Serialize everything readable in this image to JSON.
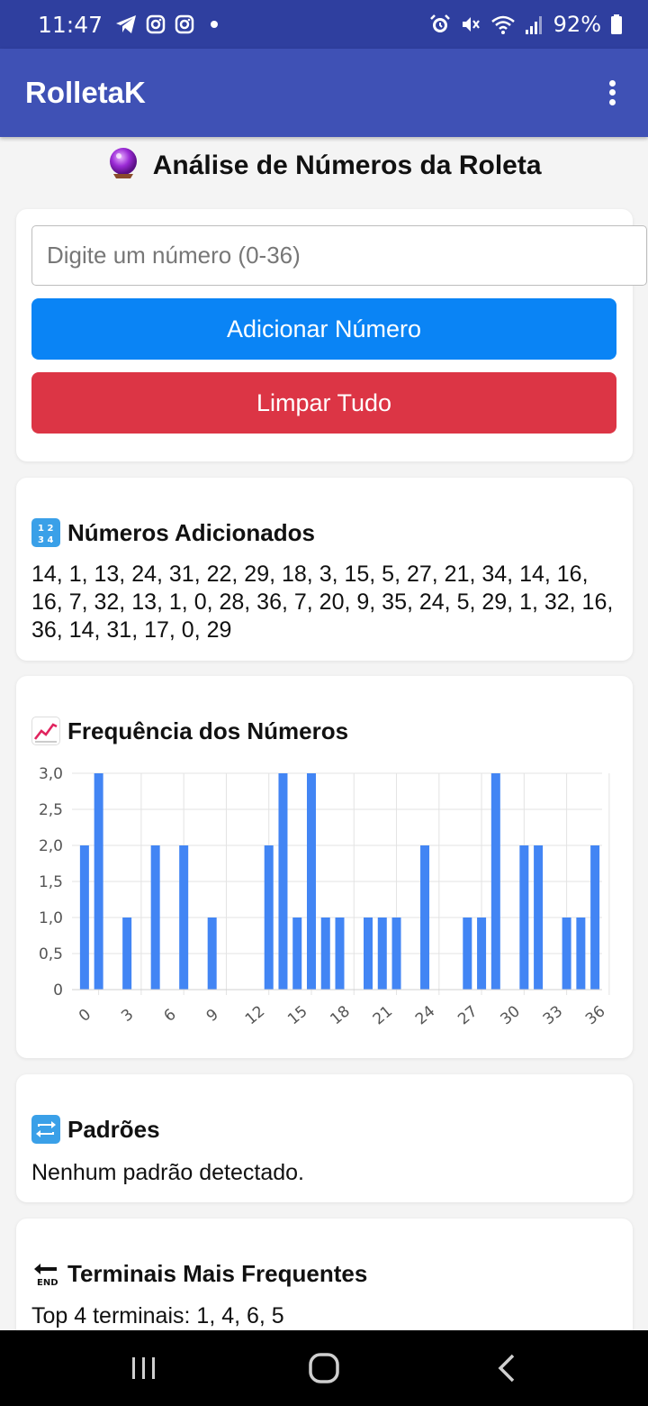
{
  "status": {
    "time": "11:47",
    "battery": "92%"
  },
  "app": {
    "title": "RolletaK"
  },
  "page": {
    "title": "Análise de Números da Roleta"
  },
  "input": {
    "placeholder": "Digite um número (0-36)",
    "value": ""
  },
  "buttons": {
    "add": "Adicionar Número",
    "clear": "Limpar Tudo"
  },
  "numbers_section": {
    "title": "Números Adicionados",
    "lines": [
      "14, 1, 13, 24, 31, 22, 29, 18, 3, 15, 5, 27, 21, 34, 14, 16,",
      "16, 7, 32, 13, 1, 0, 28, 36, 7, 20, 9, 35, 24, 5, 29, 1, 32, 16,",
      "36, 14, 31, 17, 0, 29"
    ]
  },
  "frequency_section": {
    "title": "Frequência dos Números"
  },
  "chart_data": {
    "type": "bar",
    "categories": [
      "0",
      "1",
      "2",
      "3",
      "4",
      "5",
      "6",
      "7",
      "8",
      "9",
      "10",
      "11",
      "12",
      "13",
      "14",
      "15",
      "16",
      "17",
      "18",
      "19",
      "20",
      "21",
      "22",
      "23",
      "24",
      "25",
      "26",
      "27",
      "28",
      "29",
      "30",
      "31",
      "32",
      "33",
      "34",
      "35",
      "36"
    ],
    "values": [
      2,
      3,
      0,
      1,
      0,
      2,
      0,
      2,
      0,
      1,
      0,
      0,
      0,
      2,
      3,
      1,
      3,
      1,
      1,
      0,
      1,
      1,
      1,
      0,
      2,
      0,
      0,
      1,
      1,
      3,
      0,
      2,
      2,
      0,
      1,
      1,
      2
    ],
    "ylim": [
      0,
      3
    ],
    "y_ticks": [
      "0",
      "0,5",
      "1,0",
      "1,5",
      "2,0",
      "2,5",
      "3,0"
    ],
    "x_ticks": [
      "0",
      "3",
      "6",
      "9",
      "12",
      "15",
      "18",
      "21",
      "24",
      "27",
      "30",
      "33",
      "36"
    ],
    "bar_color": "#4285f4",
    "grid": true
  },
  "patterns_section": {
    "title": "Padrões",
    "text": "Nenhum padrão detectado."
  },
  "terminals_section": {
    "title": "Terminais Mais Frequentes",
    "text": "Top 4 terminais: 1, 4, 6, 5"
  },
  "icons": {
    "telegram": "telegram-icon",
    "instagram": "instagram-icon",
    "alarm": "alarm-icon",
    "mute": "mute-icon",
    "wifi": "wifi-icon",
    "signal": "signal-icon",
    "battery": "battery-icon",
    "crystal_ball": "crystal-ball-icon",
    "numbers": "input-numbers-icon",
    "chart": "chart-increasing-icon",
    "repeat": "repeat-icon",
    "end": "end-arrow-icon"
  },
  "colors": {
    "status_bar": "#2f3f9f",
    "app_bar": "#3f51b5",
    "add_button": "#0a84f5",
    "clear_button": "#dc3545"
  }
}
